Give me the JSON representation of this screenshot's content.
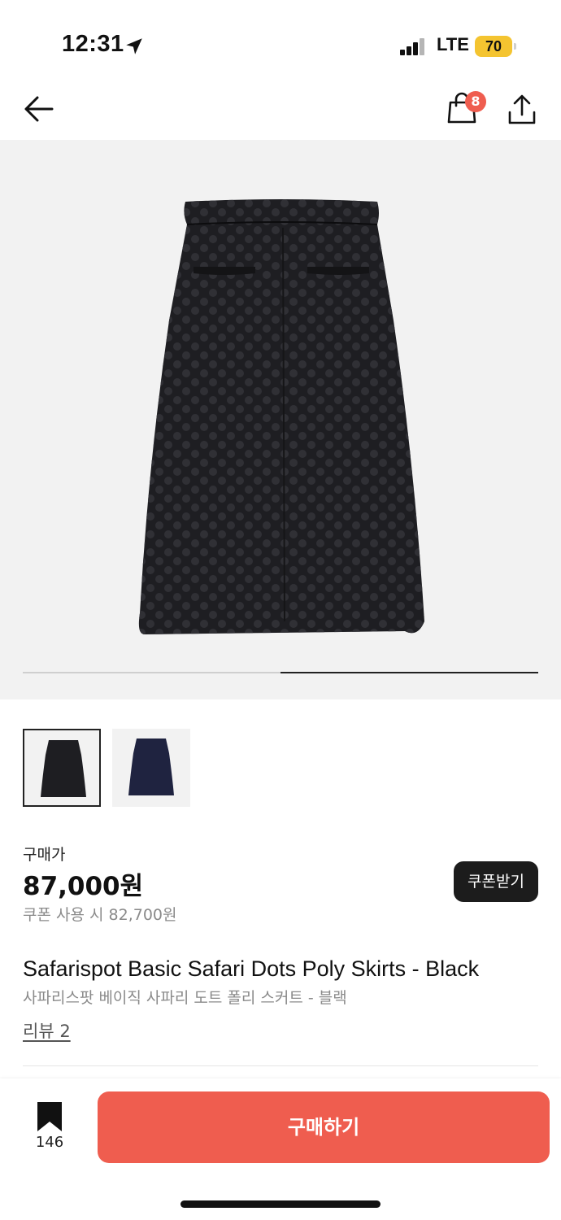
{
  "status_bar": {
    "time": "12:31",
    "network": "LTE",
    "battery": "70"
  },
  "nav": {
    "cart_count": "8",
    "icons": [
      "back-arrow-icon",
      "shopping-bag-icon",
      "share-icon"
    ]
  },
  "gallery": {
    "current_index": 1,
    "total": 2,
    "skirt_color": "#1e1e22",
    "thumbnail_colors": [
      "#1e1e22",
      "#1f2340"
    ]
  },
  "price": {
    "label": "구매가",
    "value": "87,000원",
    "coupon_text": "쿠폰 사용 시 82,700원",
    "coupon_button": "쿠폰받기"
  },
  "product": {
    "title_en": "Safarispot Basic Safari Dots Poly Skirts - Black",
    "title_ko": "사파리스팟 베이직 사파리 도트 폴리 스커트 - 블랙",
    "review_link": "리뷰 2"
  },
  "bottom_bar": {
    "bookmark_count": "146",
    "buy_button": "구매하기"
  },
  "colors": {
    "accent": "#ef5d4f",
    "dark_button": "#1c1c1c",
    "secondary_text": "#8a8a8a"
  }
}
